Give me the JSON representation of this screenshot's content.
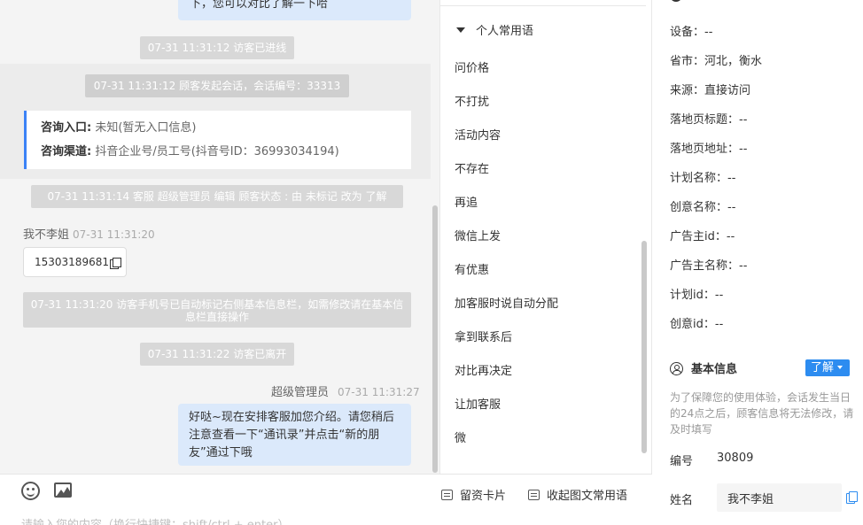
{
  "chat": {
    "top_bubble_tail": "下，您可以对比了解一下哈",
    "sys_visitor_entered": "07-31 11:31:12 访客已进线",
    "sys_session_started": "07-31 11:31:12 顾客发起会话，会话编号：33313",
    "info_card": {
      "entry_label": "咨询入口:",
      "entry_value": "未知(暂无入口信息)",
      "channel_label": "咨询渠道:",
      "channel_value": "抖音企业号/员工号(抖音号ID：36993034194)"
    },
    "sys_status_edit": "07-31 11:31:14 客服 超级管理员 编辑 顾客状态 : 由 未标记 改为 了解",
    "visitor_name": "我不李姐",
    "visitor_time": "07-31 11:31:20",
    "visitor_phone": "15303189681",
    "sys_phone_marked": "07-31 11:31:20 访客手机号已自动标记右侧基本信息栏，如需修改请在基本信息栏直接操作",
    "sys_visitor_left": "07-31 11:31:22 访客已离开",
    "agent_name": "超级管理员",
    "agent_time": "07-31 11:31:27",
    "agent_message": "好哒~现在安排客服加您介绍。请您稍后注意查看一下“通讯录”并点击“新的朋友”通过下哦"
  },
  "toolbar": {
    "emoji_icon": "smile-icon",
    "image_icon": "image-icon",
    "lead_card_label": "留资卡片",
    "collapse_label": "收起图文常用语",
    "input_placeholder": "请输入您的内容（换行快捷键：shift/ctrl + enter）"
  },
  "phrases": {
    "group_title": "个人常用语",
    "items": [
      "问价格",
      "不打扰",
      "活动内容",
      "不存在",
      "再追",
      "微信上发",
      "有优惠",
      "加客服时说自动分配",
      "拿到联系后",
      "对比再决定",
      "让加客服",
      "微"
    ]
  },
  "info": {
    "fields": [
      {
        "label": "设备：",
        "value": "--"
      },
      {
        "label": "省市：",
        "value": "河北，衡水"
      },
      {
        "label": "来源：",
        "value": "直接访问"
      },
      {
        "label": "落地页标题：",
        "value": "--"
      },
      {
        "label": "落地页地址：",
        "value": "--"
      },
      {
        "label": "计划名称：",
        "value": "--"
      },
      {
        "label": "创意名称：",
        "value": "--"
      },
      {
        "label": "广告主id：",
        "value": "--"
      },
      {
        "label": "广告主名称：",
        "value": "--"
      },
      {
        "label": "计划id：",
        "value": "--"
      },
      {
        "label": "创意id：",
        "value": "--"
      }
    ],
    "basic_title": "基本信息",
    "status_button": "了解",
    "notice": "为了保障您的使用体验，会话发生当日的24点之后，顾客信息将无法修改，请及时填写",
    "number_label": "编号",
    "number_value": "30809",
    "name_label": "姓名",
    "name_value": "我不李姐"
  }
}
